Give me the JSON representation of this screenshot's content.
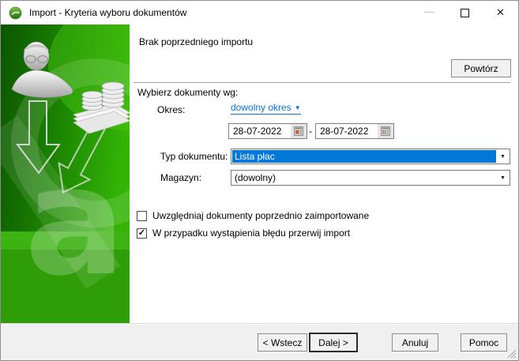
{
  "window": {
    "title": "Import - Kryteria wyboru dokumentów"
  },
  "icons": {
    "minimize": "—",
    "close": "✕",
    "dropdown_arrow": "▼",
    "link_arrow": "▼",
    "check": "✓"
  },
  "header": {
    "status_text": "Brak poprzedniego importu",
    "repeat_button_label": "Powtórz"
  },
  "form": {
    "section_label": "Wybierz dokumenty wg:",
    "period": {
      "label": "Okres:",
      "preset_link": "dowolny okres",
      "date_from": "28-07-2022",
      "range_separator": "-",
      "date_to": "28-07-2022"
    },
    "document_type": {
      "label": "Typ dokumentu:",
      "value": "Lista płac"
    },
    "warehouse": {
      "label": "Magazyn:",
      "value": "(dowolny)"
    },
    "checkboxes": [
      {
        "label": "Uwzględniaj dokumenty poprzednio zaimportowane",
        "checked": false
      },
      {
        "label": "W przypadku wystąpienia błędu przerwij import",
        "checked": true
      }
    ]
  },
  "footer": {
    "back_label": "< Wstecz",
    "next_label": "Dalej >",
    "cancel_label": "Anuluj",
    "help_label": "Pomoc"
  },
  "colors": {
    "selection_blue": "#0078d7",
    "link_blue": "#0a72d6",
    "sidebar_green_dark": "#0b5600",
    "sidebar_green_bright": "#33b405",
    "footer_gray": "#f0f0f0"
  }
}
